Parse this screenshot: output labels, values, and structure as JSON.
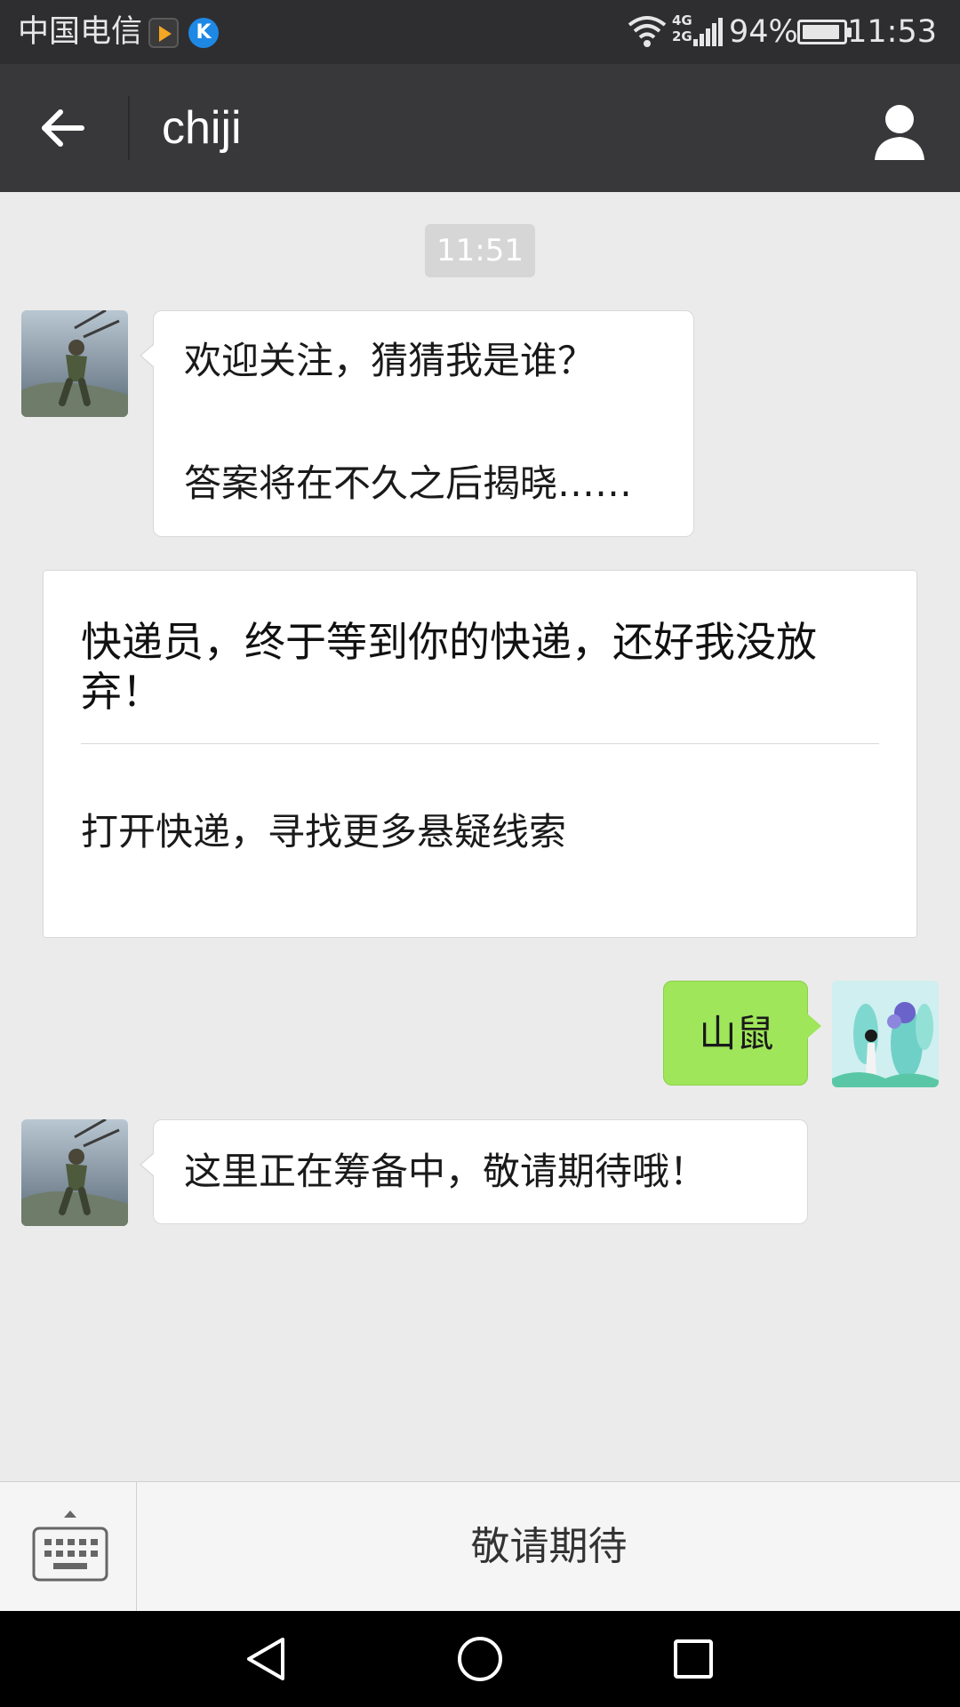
{
  "status_bar": {
    "carrier": "中国电信",
    "app2_letter": "K",
    "network": "4G\n2G",
    "battery_percent": "94%",
    "battery_level": 0.94,
    "time": "11:53"
  },
  "title_bar": {
    "title": "chiji",
    "back_icon": "arrow-left-icon",
    "profile_icon": "person-icon"
  },
  "chat": {
    "timestamp": "11:51",
    "messages": [
      {
        "sender": "account",
        "line1": "欢迎关注，猜猜我是谁？",
        "line2": "答案将在不久之后揭晓……"
      },
      {
        "sender": "account-card",
        "title": "快递员，终于等到你的快递，还好我没放弃！",
        "link_text": "打开快递，寻找更多悬疑线索"
      },
      {
        "sender": "me",
        "text": "山鼠"
      },
      {
        "sender": "account",
        "text": "这里正在筹备中，敬请期待哦！"
      }
    ]
  },
  "menu_bar": {
    "keyboard_icon": "keyboard-icon",
    "item_label": "敬请期待"
  },
  "nav_bar": {
    "back_icon": "triangle-back-icon",
    "home_icon": "circle-home-icon",
    "recents_icon": "square-recents-icon"
  },
  "colors": {
    "title_bar": "#38383b",
    "chat_background": "#ebebeb",
    "sent_bubble": "#9fe65a"
  }
}
